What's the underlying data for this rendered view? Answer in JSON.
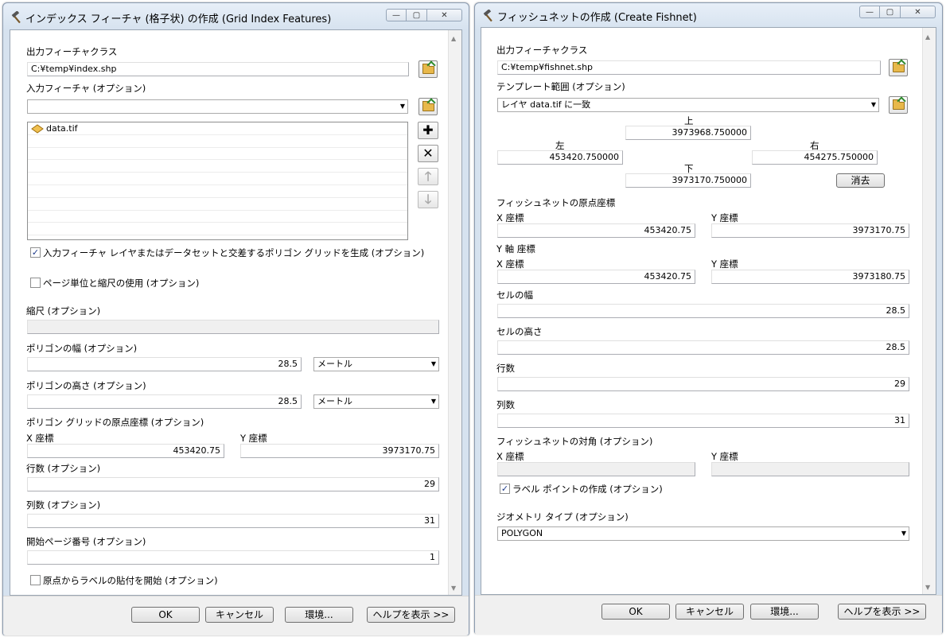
{
  "left_dialog": {
    "title": "インデックス フィーチャ (格子状) の作成 (Grid Index Features)",
    "output_fc_label": "出力フィーチャクラス",
    "output_fc_value": "C:¥temp¥index.shp",
    "input_features_label": "入力フィーチャ (オプション)",
    "input_features_value": "",
    "input_list": [
      "data.tif"
    ],
    "generate_polygons_label": "入力フィーチャ レイヤまたはデータセットと交差するポリゴン グリッドを生成 (オプション)",
    "generate_polygons_checked": true,
    "use_page_units_label": "ページ単位と縮尺の使用 (オプション)",
    "use_page_units_checked": false,
    "scale_label": "縮尺 (オプション)",
    "scale_value": "",
    "polygon_width_label": "ポリゴンの幅 (オプション)",
    "polygon_width_value": "28.5",
    "polygon_width_unit": "メートル",
    "polygon_height_label": "ポリゴンの高さ (オプション)",
    "polygon_height_value": "28.5",
    "polygon_height_unit": "メートル",
    "origin_label": "ポリゴン グリッドの原点座標 (オプション)",
    "x_coord_label": "X 座標",
    "x_coord_value": "453420.75",
    "y_coord_label": "Y 座標",
    "y_coord_value": "3973170.75",
    "rows_label": "行数 (オプション)",
    "rows_value": "29",
    "cols_label": "列数 (オプション)",
    "cols_value": "31",
    "start_page_label": "開始ページ番号 (オプション)",
    "start_page_value": "1",
    "label_from_origin_label": "原点からラベルの貼付を開始 (オプション)",
    "label_from_origin_checked": false,
    "ok": "OK",
    "cancel": "キャンセル",
    "env": "環境...",
    "help": "ヘルプを表示 >>"
  },
  "right_dialog": {
    "title": "フィッシュネットの作成 (Create Fishnet)",
    "output_fc_label": "出力フィーチャクラス",
    "output_fc_value": "C:¥temp¥fishnet.shp",
    "template_extent_label": "テンプレート範囲 (オプション)",
    "template_extent_value": "レイヤ data.tif に一致",
    "top_label": "上",
    "top_value": "3973968.750000",
    "left_label": "左",
    "left_value": "453420.750000",
    "right_label": "右",
    "right_value": "454275.750000",
    "bottom_label": "下",
    "bottom_value": "3973170.750000",
    "clear": "消去",
    "origin_label": "フィッシュネットの原点座標",
    "origin_x_label": "X 座標",
    "origin_x_value": "453420.75",
    "origin_y_label": "Y 座標",
    "origin_y_value": "3973170.75",
    "yaxis_label": "Y 軸 座標",
    "yaxis_x_label": "X 座標",
    "yaxis_x_value": "453420.75",
    "yaxis_y_label": "Y 座標",
    "yaxis_y_value": "3973180.75",
    "cell_width_label": "セルの幅",
    "cell_width_value": "28.5",
    "cell_height_label": "セルの高さ",
    "cell_height_value": "28.5",
    "rows_label": "行数",
    "rows_value": "29",
    "cols_label": "列数",
    "cols_value": "31",
    "corner_label": "フィッシュネットの対角 (オプション)",
    "corner_x_label": "X 座標",
    "corner_x_value": "",
    "corner_y_label": "Y 座標",
    "corner_y_value": "",
    "label_points_label": "ラベル ポイントの作成 (オプション)",
    "label_points_checked": true,
    "geometry_type_label": "ジオメトリ タイプ (オプション)",
    "geometry_type_value": "POLYGON",
    "ok": "OK",
    "cancel": "キャンセル",
    "env": "環境...",
    "help": "ヘルプを表示 >>"
  },
  "window_controls": {
    "minimize": "—",
    "maximize": "▢",
    "close": "✕"
  }
}
